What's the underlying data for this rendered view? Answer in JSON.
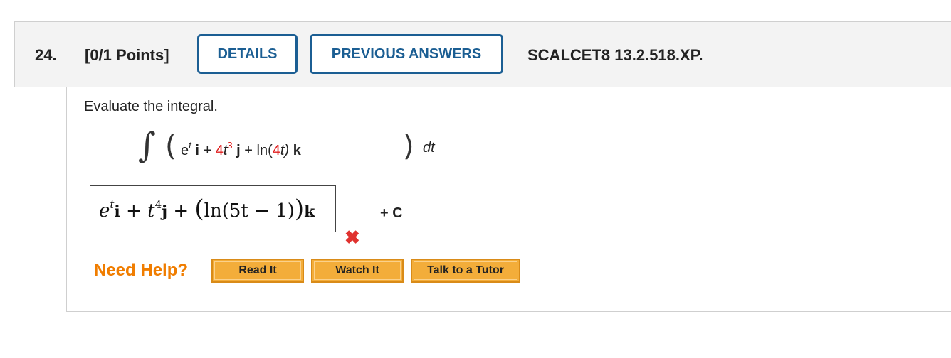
{
  "question": {
    "number": "24.",
    "points": "[0/1 Points]",
    "details_label": "DETAILS",
    "previous_answers_label": "PREVIOUS ANSWERS",
    "code": "SCALCET8 13.2.518.XP."
  },
  "problem": {
    "prompt": "Evaluate the integral.",
    "integral_sign": "∫",
    "paren_left": "(",
    "paren_right": ")",
    "term1_base": "e",
    "term1_exp": "t",
    "term1_vec": "i",
    "op1": "+",
    "term2_coef": "4",
    "term2_var": "t",
    "term2_exp": "3",
    "term2_vec": "j",
    "op2": "+",
    "term3_fn": "ln(",
    "term3_coef": "4",
    "term3_var": "t)",
    "term3_vec": "k",
    "differential": "dt"
  },
  "answer": {
    "e": "e",
    "t_exp": "t",
    "i": "i",
    "plus1": "+",
    "t": "t",
    "four": "4",
    "j": "j",
    "plus2": "+",
    "paren_open": "(",
    "ln_expr": "ln(5t − 1)",
    "paren_close": ")",
    "k": "k",
    "constant": "+ C",
    "status": "✖"
  },
  "help": {
    "label": "Need Help?",
    "read_it": "Read It",
    "watch_it": "Watch It",
    "talk_to_tutor": "Talk to a Tutor"
  }
}
